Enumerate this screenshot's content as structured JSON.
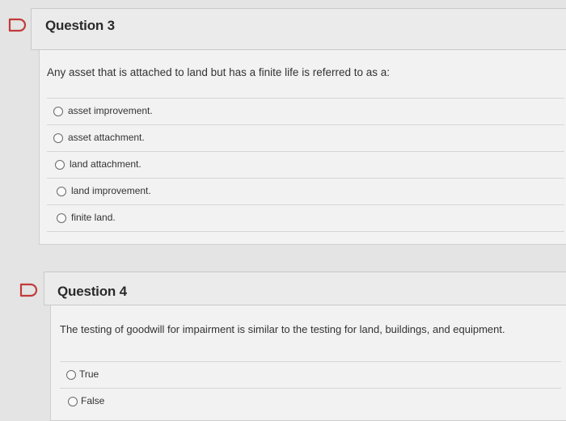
{
  "questions": [
    {
      "title": "Question 3",
      "text": "Any asset that is attached to land but has a finite life is referred to as a:",
      "options": [
        "asset improvement.",
        "asset attachment.",
        "land attachment.",
        "land improvement.",
        "finite land."
      ],
      "flag_color": "#c23b3b"
    },
    {
      "title": "Question 4",
      "text": "The testing of goodwill for impairment is similar to the testing for land, buildings, and equipment.",
      "options": [
        "True",
        "False"
      ],
      "flag_color": "#c23b3b"
    }
  ]
}
